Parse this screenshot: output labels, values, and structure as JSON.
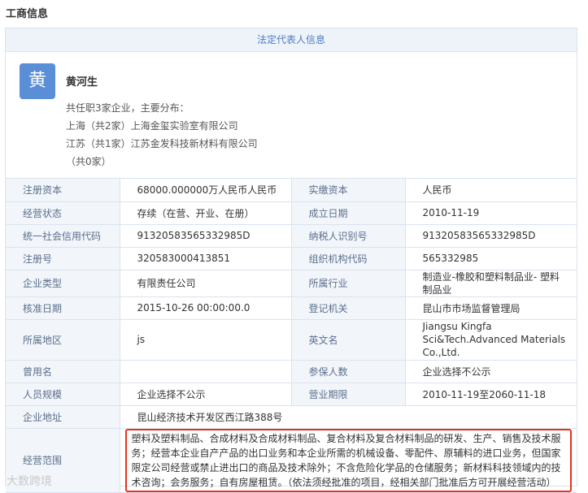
{
  "section_title": "工商信息",
  "legal_rep": {
    "header": "法定代表人信息",
    "avatar_char": "黄",
    "name": "黄河生",
    "summary": "共任职3家企业，主要分布：",
    "locations": [
      {
        "prefix": "上海（共2家）",
        "company": "上海金玺实验室有限公司"
      },
      {
        "prefix": "江苏（共1家）",
        "company": "江苏金发科技新材料有限公司"
      },
      {
        "prefix": "（共0家）",
        "company": ""
      }
    ]
  },
  "rows": [
    {
      "l1": "注册资本",
      "v1": "68000.000000万人民币人民币",
      "l2": "实缴资本",
      "v2": "人民币"
    },
    {
      "l1": "经营状态",
      "v1": "存续（在营、开业、在册）",
      "l2": "成立日期",
      "v2": "2010-11-19"
    },
    {
      "l1": "统一社会信用代码",
      "v1": "91320583565332985D",
      "l2": "纳税人识别号",
      "v2": "91320583565332985D"
    },
    {
      "l1": "注册号",
      "v1": "320583000413851",
      "l2": "组织机构代码",
      "v2": "565332985"
    },
    {
      "l1": "企业类型",
      "v1": "有限责任公司",
      "l2": "所属行业",
      "v2": "制造业-橡胶和塑料制品业- 塑料制品业"
    },
    {
      "l1": "核准日期",
      "v1": "2015-10-26 00:00:00.0",
      "l2": "登记机关",
      "v2": "昆山市市场监督管理局"
    },
    {
      "l1": "所属地区",
      "v1": "js",
      "l2": "英文名",
      "v2": "Jiangsu Kingfa Sci&Tech.Advanced Materials Co.,Ltd."
    },
    {
      "l1": "曾用名",
      "v1": "",
      "l2": "参保人数",
      "v2": "企业选择不公示"
    },
    {
      "l1": "人员规模",
      "v1": "企业选择不公示",
      "l2": "营业期限",
      "v2": "2010-11-19至2060-11-18"
    }
  ],
  "address": {
    "label": "企业地址",
    "value": "昆山经济技术开发区西江路388号"
  },
  "scope": {
    "label": "经营范围",
    "value": "塑料及塑料制品、合成材料及合成材料制品、复合材料及复合材料制品的研发、生产、销售及技术服务；经营本企业自产产品的出口业务和本企业所需的机械设备、零配件、原辅料的进口业务，但国家限定公司经营或禁止进出口的商品及技术除外；不含危险化学品的仓储服务；新材料科技领域内的技术咨询；会务服务；自有房屋租赁。（依法须经批准的项目，经相关部门批准后方可开展经营活动）"
  },
  "watermark": "大数跨境"
}
